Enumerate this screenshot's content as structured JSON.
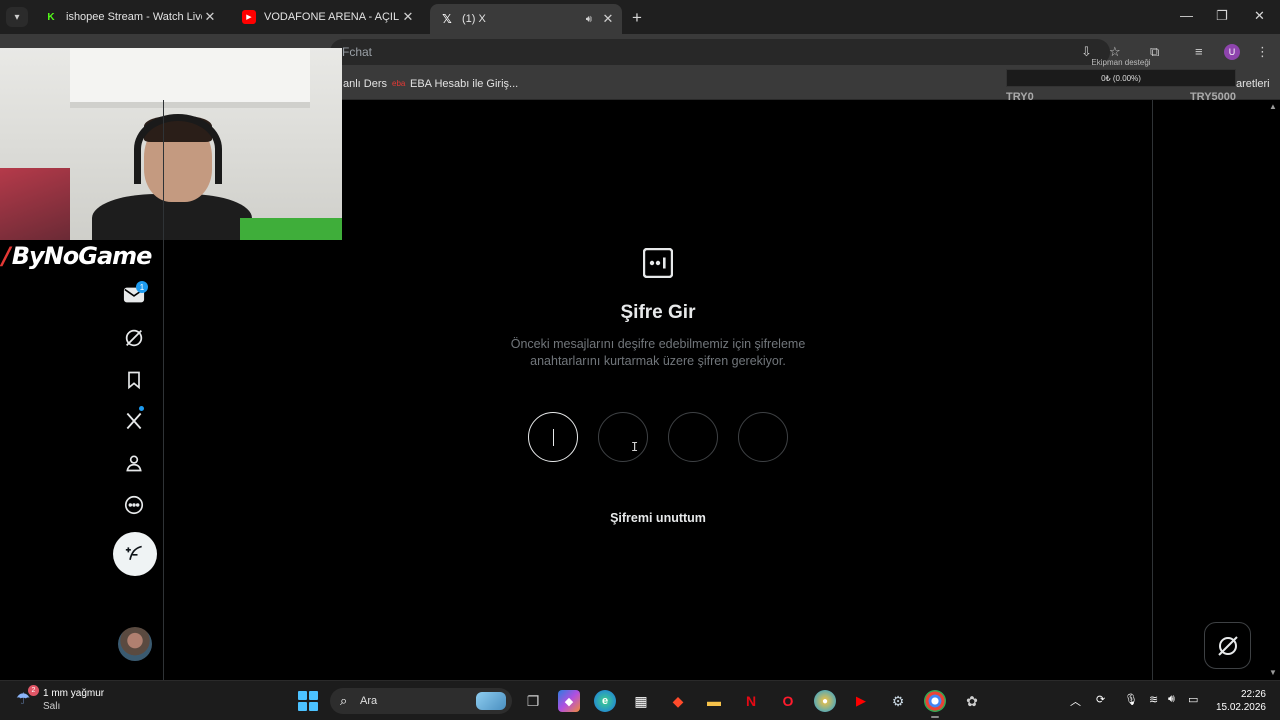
{
  "browser": {
    "tabs": [
      {
        "title": "ishopee Stream - Watch Live on",
        "favicon": "kick-icon",
        "color": "#53fc18"
      },
      {
        "title": "VODAFONE ARENA - AÇILIŞ MA",
        "favicon": "youtube-icon",
        "color": "#ff0000"
      },
      {
        "title": "(1) X",
        "favicon": "x-icon",
        "color": "#ffffff",
        "active": true
      }
    ],
    "address_partial": "Fchat",
    "bookmarks": [
      {
        "label": "anlı Ders"
      },
      {
        "label": "EBA Hesabı ile Giriş..."
      }
    ],
    "bookmarks_right": "aretleri",
    "profile_initial": "U"
  },
  "donation": {
    "title": "Ekipman desteği",
    "progress_text": "0₺ (0.00%)",
    "progress_fraction": 0.0,
    "min_label": "TRY0",
    "max_label": "TRY5000"
  },
  "stream": {
    "brand_name": "ByNoGame"
  },
  "nav": {
    "items": [
      {
        "name": "messages",
        "badge": "1"
      },
      {
        "name": "grok"
      },
      {
        "name": "bookmarks"
      },
      {
        "name": "premium"
      },
      {
        "name": "profile"
      },
      {
        "name": "more"
      }
    ]
  },
  "passcode": {
    "heading": "Şifre Gir",
    "description_line1": "Önceki mesajlarını deşifre edebilmemiz için şifreleme",
    "description_line2": "anahtarlarını kurtarmak üzere şifren gerekiyor.",
    "digits": [
      "",
      "",
      "",
      ""
    ],
    "forgot_label": "Şifremi unuttum"
  },
  "taskbar": {
    "weather_text": "1 mm yağmur",
    "weather_sub": "Salı",
    "weather_badge": "2",
    "search_placeholder": "Ara",
    "time": "22:26",
    "date": "15.02.2026"
  }
}
